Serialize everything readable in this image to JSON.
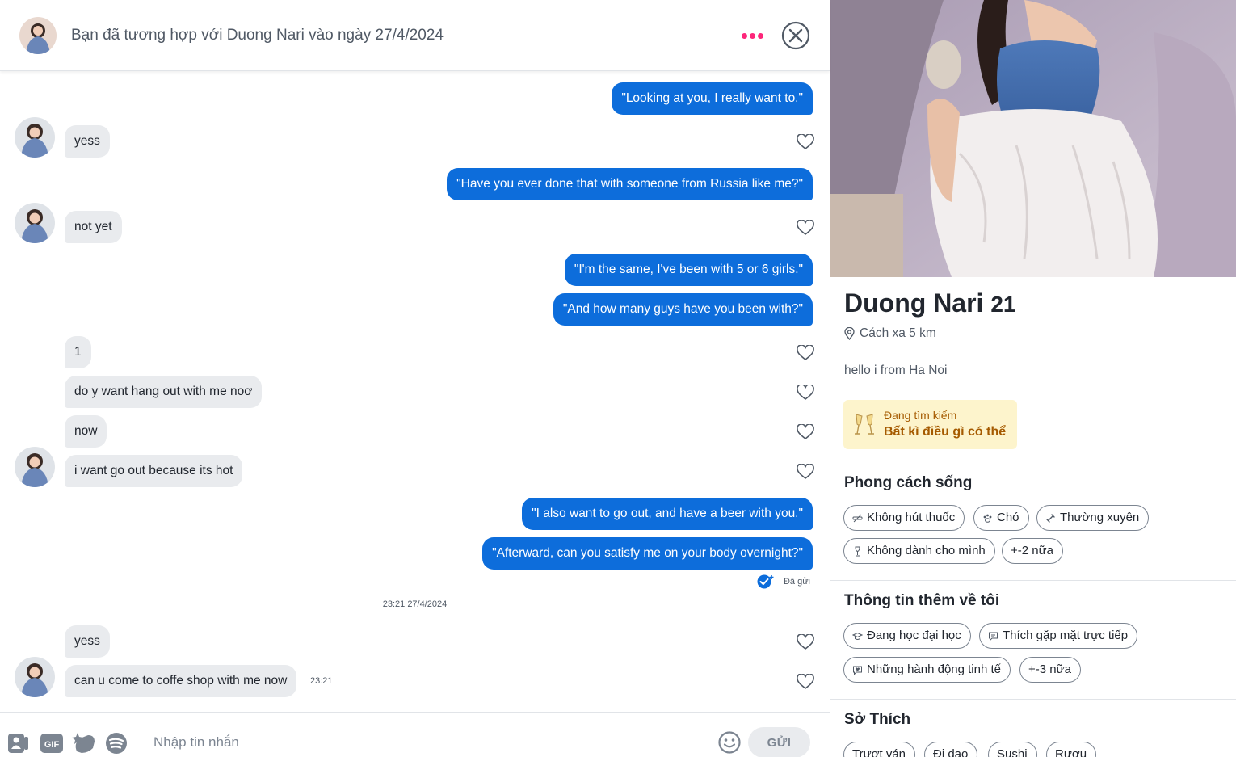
{
  "header": {
    "title": "Bạn đã tương hợp với Duong Nari vào ngày 27/4/2024"
  },
  "messages": [
    {
      "text": "\"Looking at you, I really want to.\""
    },
    {
      "text": "yess"
    },
    {
      "text": "\"Have you ever done that with someone from Russia like me?\""
    },
    {
      "text": "not yet"
    },
    {
      "text": "\"I'm the same, I've been with 5 or 6 girls.\""
    },
    {
      "text": "\"And how many guys have you been with?\""
    },
    {
      "text": "1"
    },
    {
      "text": "do y want hang out with me noơ"
    },
    {
      "text": "now"
    },
    {
      "text": "i want go out because its hot"
    },
    {
      "text": "\"I also want to go out, and have a beer with you.\""
    },
    {
      "text": "\"Afterward, can you satisfy me on your body overnight?\""
    },
    {
      "text": "yess"
    },
    {
      "text": "can u come to coffe shop with me now"
    }
  ],
  "status": {
    "sent_label": "Đã gửi",
    "timestamp": "23:21 27/4/2024",
    "last_time": "23:21"
  },
  "composer": {
    "placeholder": "Nhập tin nhắn",
    "send_label": "GỬI",
    "gif_label": "GIF"
  },
  "profile": {
    "name": "Duong Nari",
    "age": "21",
    "distance": "Cách xa 5 km",
    "bio": "hello i from Ha Noi",
    "looking_label": "Đang tìm kiếm",
    "looking_value": "Bất kì điều gì có thể",
    "lifestyle_title": "Phong cách sống",
    "lifestyle": [
      "Không hút thuốc",
      "Chó",
      "Thường xuyên",
      "Không dành cho mình",
      "+-2 nữa"
    ],
    "more_title": "Thông tin thêm về tôi",
    "more_info": [
      "Đang học đại học",
      "Thích gặp mặt trực tiếp",
      "Những hành động tinh tế",
      "+-3 nữa"
    ],
    "interests_title": "Sở Thích",
    "interests": [
      "Trượt ván",
      "Đi dạo",
      "Sushi",
      "Rượu"
    ]
  },
  "colors": {
    "brand": "#fd267a",
    "outgoing_bubble": "#0d6ddb",
    "incoming_bubble": "#e9ebee",
    "looking_bg": "#fdf4cc"
  }
}
